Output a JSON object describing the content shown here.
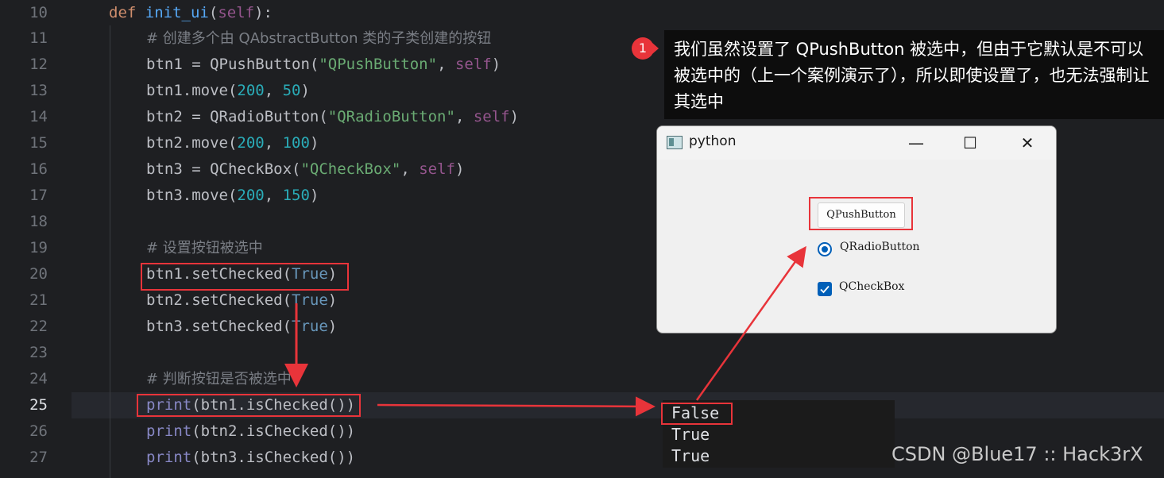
{
  "editor": {
    "line_numbers": [
      "10",
      "11",
      "12",
      "13",
      "14",
      "15",
      "16",
      "17",
      "18",
      "19",
      "20",
      "21",
      "22",
      "23",
      "24",
      "25",
      "26",
      "27"
    ],
    "active_line": "25",
    "code": {
      "l10_kw": "def",
      "l10_fn": "init_ui",
      "l10_rest1": "(",
      "l10_self": "self",
      "l10_rest2": "):",
      "l11": "# 创建多个由 QAbstractButton 类的子类创建的按钮",
      "l12_a": "btn1 = QPushButton(",
      "l12_str": "\"QPushButton\"",
      "l12_b": ", ",
      "l12_self": "self",
      "l12_c": ")",
      "l13_a": "btn1.move(",
      "l13_n1": "200",
      "l13_b": ", ",
      "l13_n2": "50",
      "l13_c": ")",
      "l14_a": "btn2 = QRadioButton(",
      "l14_str": "\"QRadioButton\"",
      "l14_b": ", ",
      "l14_self": "self",
      "l14_c": ")",
      "l15_a": "btn2.move(",
      "l15_n1": "200",
      "l15_b": ", ",
      "l15_n2": "100",
      "l15_c": ")",
      "l16_a": "btn3 = QCheckBox(",
      "l16_str": "\"QCheckBox\"",
      "l16_b": ", ",
      "l16_self": "self",
      "l16_c": ")",
      "l17_a": "btn3.move(",
      "l17_n1": "200",
      "l17_b": ", ",
      "l17_n2": "150",
      "l17_c": ")",
      "l19": "# 设置按钮被选中",
      "l20_a": "btn1.setChecked(",
      "l20_t": "True",
      "l20_c": ")",
      "l21_a": "btn2.setChecked(",
      "l21_t": "True",
      "l21_c": ")",
      "l22_a": "btn3.setChecked(",
      "l22_t": "True",
      "l22_c": ")",
      "l24": "# 判断按钮是否被选中",
      "l25_p": "print",
      "l25_rest": "(btn1.isChecked())",
      "l26_p": "print",
      "l26_rest": "(btn2.isChecked())",
      "l27_p": "print",
      "l27_rest": "(btn3.isChecked())"
    }
  },
  "tooltip": {
    "badge": "1",
    "text": "我们虽然设置了 QPushButton 被选中，但由于它默认是不可以被选中的（上一个案例演示了），所以即使设置了，也无法强制让其选中"
  },
  "window": {
    "title": "python",
    "minimize_glyph": "—",
    "maximize_glyph": "☐",
    "close_glyph": "✕",
    "push_button_label": "QPushButton",
    "radio_label": "QRadioButton",
    "radio_checked": true,
    "checkbox_label": "QCheckBox",
    "checkbox_checked": true,
    "icon": "python-window-icon"
  },
  "console": {
    "lines": [
      "False",
      "True",
      "True"
    ]
  },
  "watermark": "CSDN @Blue17 :: Hack3rX",
  "colors": {
    "highlight": "#e8343a",
    "accent": "#005fb8"
  }
}
